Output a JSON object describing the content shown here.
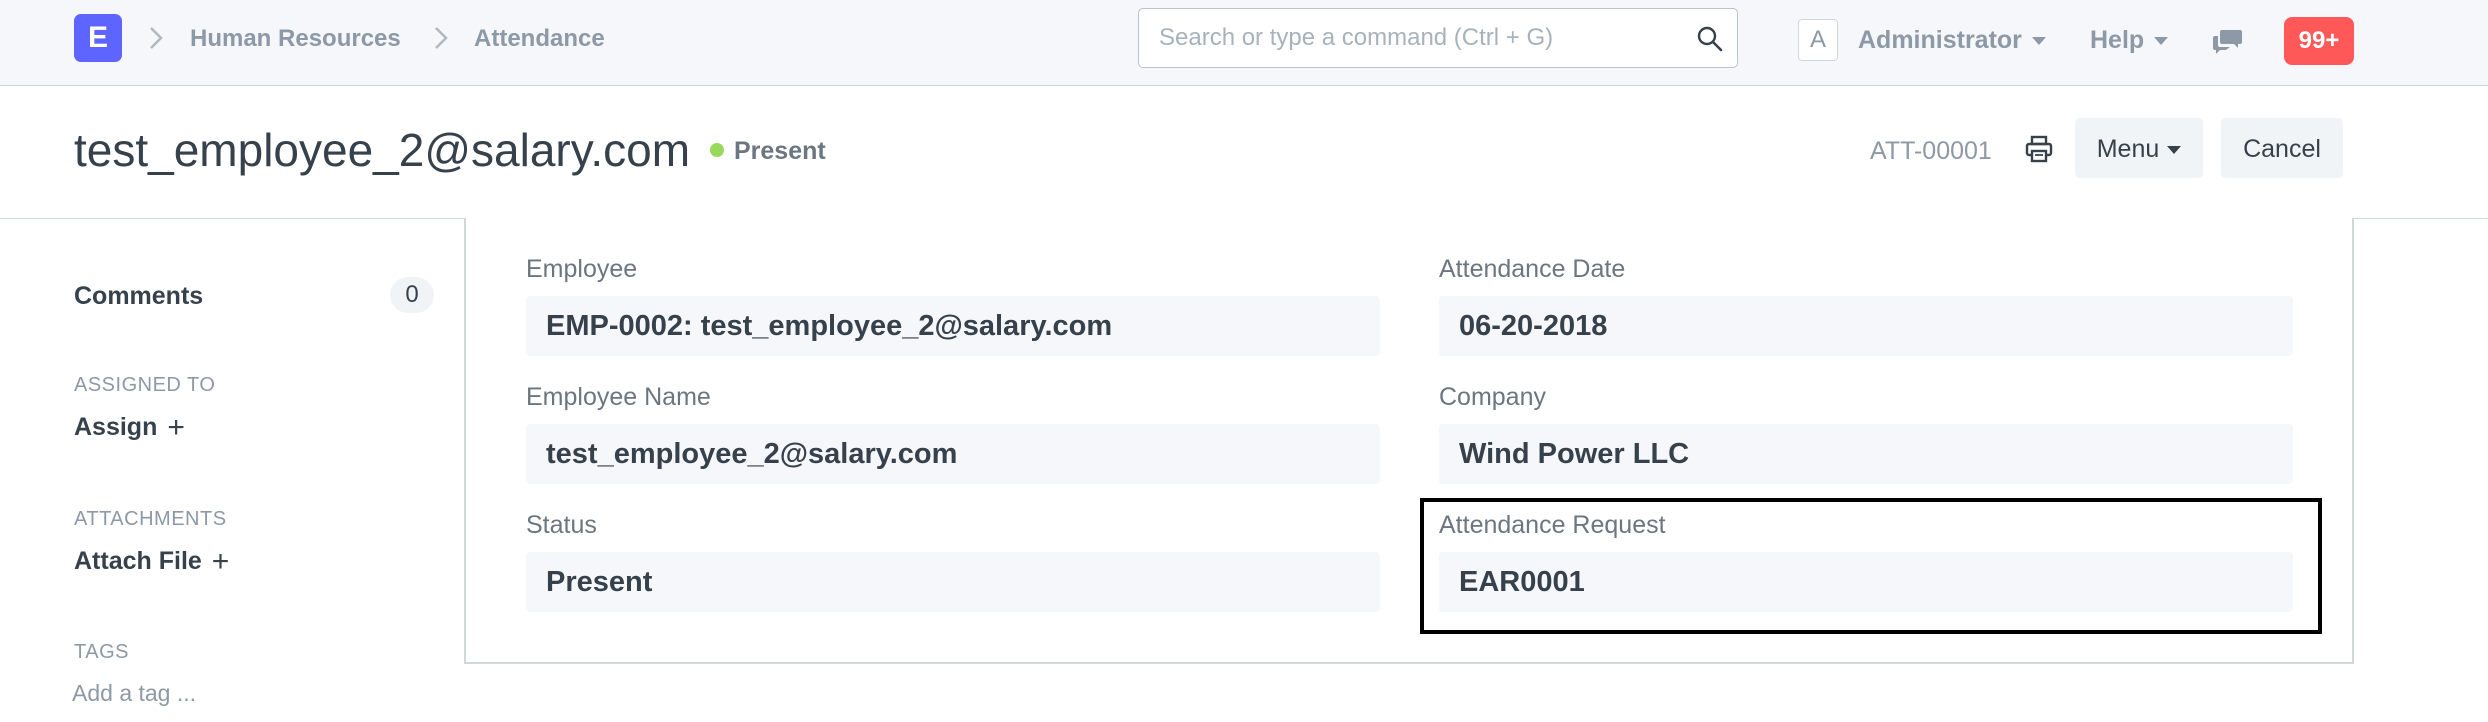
{
  "navbar": {
    "logo_letter": "E",
    "breadcrumbs": [
      "Human Resources",
      "Attendance"
    ],
    "search_placeholder": "Search or type a command (Ctrl + G)",
    "avatar_letter": "A",
    "user_menu": "Administrator",
    "help_menu": "Help",
    "notifications": "99+"
  },
  "page_head": {
    "title": "test_employee_2@salary.com",
    "status": "Present",
    "status_color": "#98d85b",
    "doc_id": "ATT-00001",
    "menu_label": "Menu",
    "cancel_label": "Cancel"
  },
  "sidebar": {
    "comments_label": "Comments",
    "comments_count": "0",
    "assigned_heading": "ASSIGNED TO",
    "assign_label": "Assign",
    "attachments_heading": "ATTACHMENTS",
    "attach_label": "Attach File",
    "tags_heading": "TAGS",
    "tag_placeholder": "Add a tag ..."
  },
  "form": {
    "employee": {
      "label": "Employee",
      "value": "EMP-0002: test_employee_2@salary.com"
    },
    "employee_name": {
      "label": "Employee Name",
      "value": "test_employee_2@salary.com"
    },
    "status": {
      "label": "Status",
      "value": "Present"
    },
    "attendance_date": {
      "label": "Attendance Date",
      "value": "06-20-2018"
    },
    "company": {
      "label": "Company",
      "value": "Wind Power LLC"
    },
    "attendance_request": {
      "label": "Attendance Request",
      "value": "EAR0001"
    }
  }
}
